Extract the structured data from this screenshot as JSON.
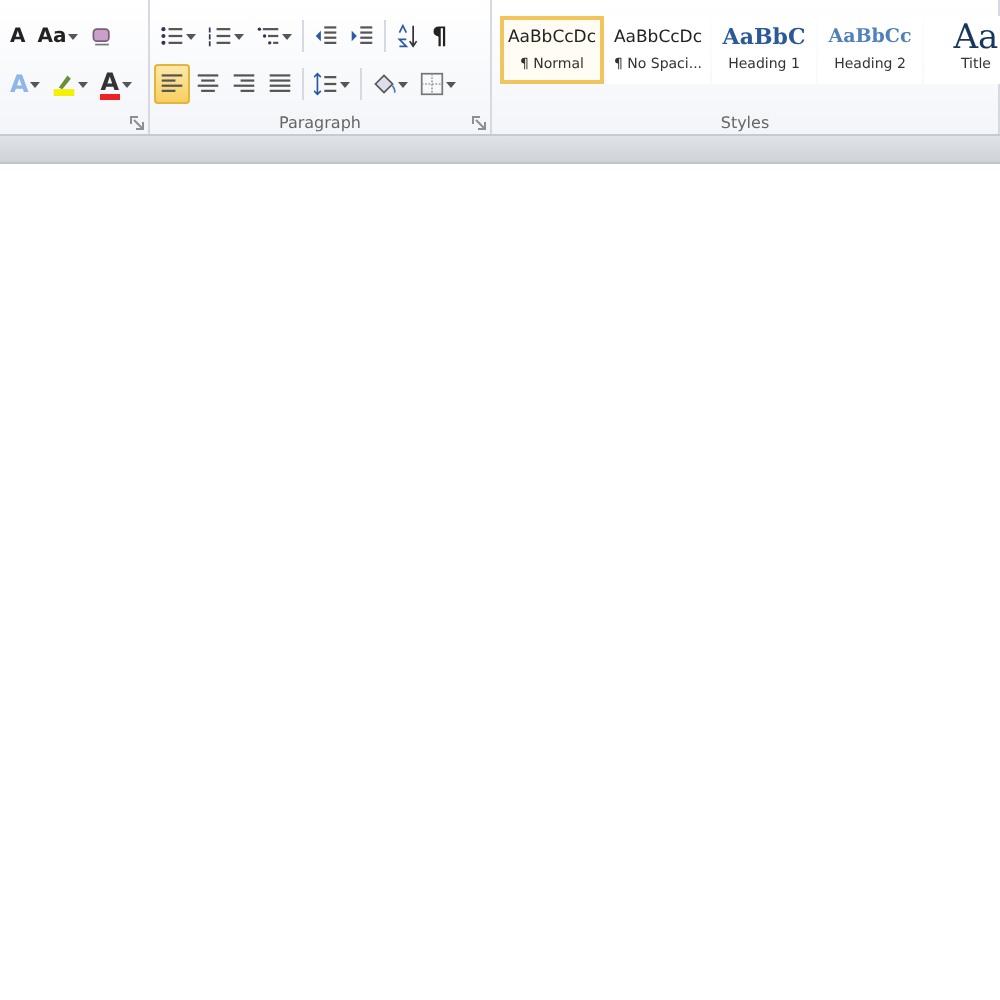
{
  "font_group": {
    "rows": [
      [
        {
          "kind": "shrink-font",
          "label": "A"
        },
        {
          "kind": "change-case",
          "label": "Aa",
          "has_dropdown": true
        },
        {
          "kind": "clear-format"
        }
      ],
      [
        {
          "kind": "text-effects",
          "label": "A",
          "has_dropdown": true
        },
        {
          "kind": "highlight",
          "has_dropdown": true
        },
        {
          "kind": "font-color",
          "label": "A",
          "has_dropdown": true
        }
      ]
    ]
  },
  "paragraph_group": {
    "label": "Paragraph",
    "rows": [
      [
        {
          "kind": "bullets",
          "has_dropdown": true,
          "selected": false
        },
        {
          "kind": "numbering",
          "has_dropdown": true,
          "selected": false
        },
        {
          "kind": "multilevel",
          "has_dropdown": true,
          "selected": false
        },
        {
          "kind": "decrease-indent",
          "selected": false
        },
        {
          "kind": "increase-indent",
          "selected": false
        },
        {
          "kind": "sort",
          "selected": false
        },
        {
          "kind": "pilcrow",
          "label": "¶",
          "selected": false
        }
      ],
      [
        {
          "kind": "align-left",
          "selected": true
        },
        {
          "kind": "align-center",
          "selected": false
        },
        {
          "kind": "align-right",
          "selected": false
        },
        {
          "kind": "justify",
          "selected": false
        },
        {
          "kind": "line-spacing",
          "has_dropdown": true,
          "selected": false
        },
        {
          "kind": "shading",
          "has_dropdown": true,
          "selected": false
        },
        {
          "kind": "borders",
          "has_dropdown": true,
          "selected": false
        }
      ]
    ]
  },
  "styles_group": {
    "label": "Styles",
    "items": [
      {
        "kind": "normal",
        "preview": "AaBbCcDc",
        "name": "¶ Normal",
        "selected": true
      },
      {
        "kind": "normal",
        "preview": "AaBbCcDc",
        "name": "¶ No Spaci...",
        "selected": false
      },
      {
        "kind": "heading1",
        "preview": "AaBbC",
        "name": "Heading 1",
        "selected": false
      },
      {
        "kind": "heading2",
        "preview": "AaBbCc",
        "name": "Heading 2",
        "selected": false
      },
      {
        "kind": "title",
        "preview": "Aa",
        "name": "Title",
        "selected": false
      }
    ]
  }
}
